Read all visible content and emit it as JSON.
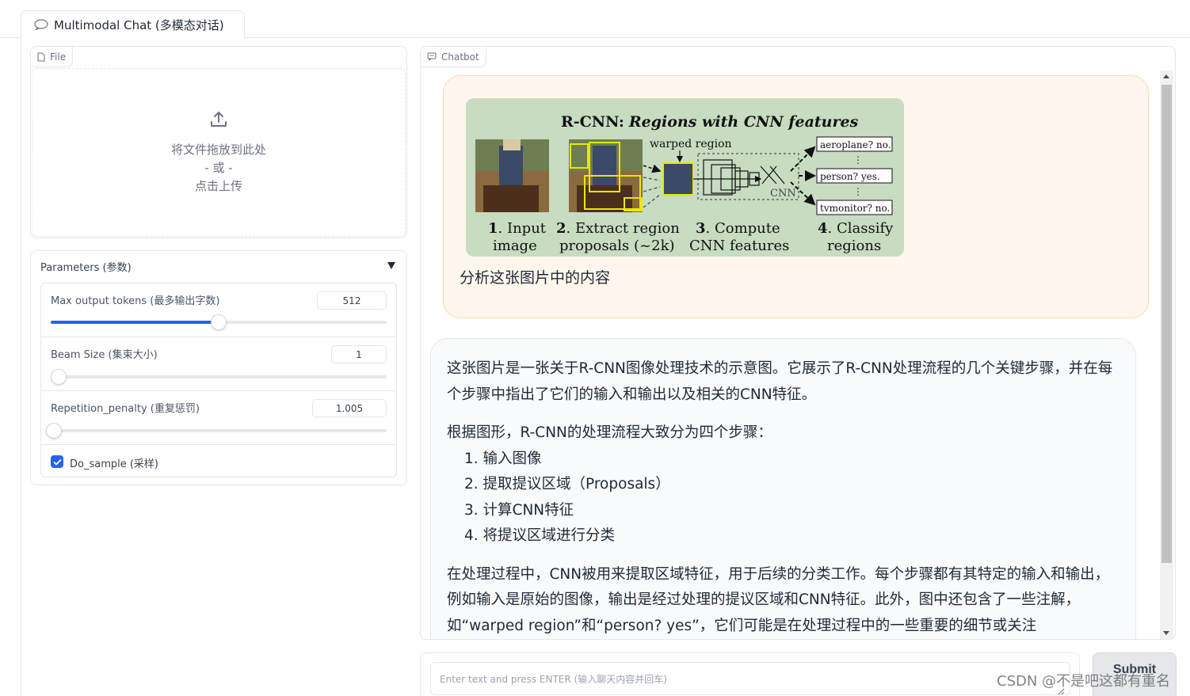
{
  "tab": {
    "label": "Multimodal Chat (多模态对话)"
  },
  "file_panel": {
    "label": "File",
    "drop_text": "将文件拖放到此处",
    "or_text": "- 或 -",
    "click_text": "点击上传"
  },
  "parameters": {
    "title": "Parameters (参数)",
    "max_tokens": {
      "label": "Max output tokens (最多输出字数)",
      "value": "512",
      "fraction": 0.5
    },
    "beam_size": {
      "label": "Beam Size (集束大小)",
      "value": "1",
      "fraction": 0.0
    },
    "repetition_penalty": {
      "label": "Repetition_penalty (重复惩罚)",
      "value": "1.005",
      "fraction": 0.01
    },
    "do_sample": {
      "label": "Do_sample (采样)",
      "checked": true
    }
  },
  "chatbot": {
    "label": "Chatbot",
    "user_message": "分析这张图片中的内容",
    "image": {
      "title_prefix": "R-CNN:",
      "title_italic": "Regions with CNN features",
      "warped_region": "warped region",
      "cnn": "CNN",
      "outputs": [
        "aeroplane? no.",
        "person? yes.",
        "tvmonitor? no."
      ],
      "steps": [
        {
          "num": "1",
          "line1": ". Input",
          "line2": "image"
        },
        {
          "num": "2",
          "line1": ". Extract region",
          "line2": "proposals (~2k)"
        },
        {
          "num": "3",
          "line1": ". Compute",
          "line2": "CNN features"
        },
        {
          "num": "4",
          "line1": ". Classify",
          "line2": "regions"
        }
      ]
    },
    "bot_paragraph_1": "这张图片是一张关于R-CNN图像处理技术的示意图。它展示了R-CNN处理流程的几个关键步骤，并在每个步骤中指出了它们的输入和输出以及相关的CNN特征。",
    "bot_paragraph_2": "根据图形，R-CNN的处理流程大致分为四个步骤：",
    "bot_list": [
      "1. 输入图像",
      "2. 提取提议区域（Proposals）",
      "3. 计算CNN特征",
      "4. 将提议区域进行分类"
    ],
    "bot_paragraph_3": "在处理过程中，CNN被用来提取区域特征，用于后续的分类工作。每个步骤都有其特定的输入和输出，例如输入是原始的图像，输出是经过处理的提议区域和CNN特征。此外，图中还包含了一些注解，如“warped region”和“person? yes”，它们可能是在处理过程中的一些重要的细节或关注"
  },
  "input": {
    "placeholder": "Enter text and press ENTER (输入聊天内容并回车)"
  },
  "submit": {
    "label": "Submit"
  },
  "watermark": "CSDN @不是吧这都有重名",
  "colors": {
    "accent": "#2563eb",
    "user_bubble": "#fff7ed",
    "bot_bubble": "#f9fafb"
  }
}
